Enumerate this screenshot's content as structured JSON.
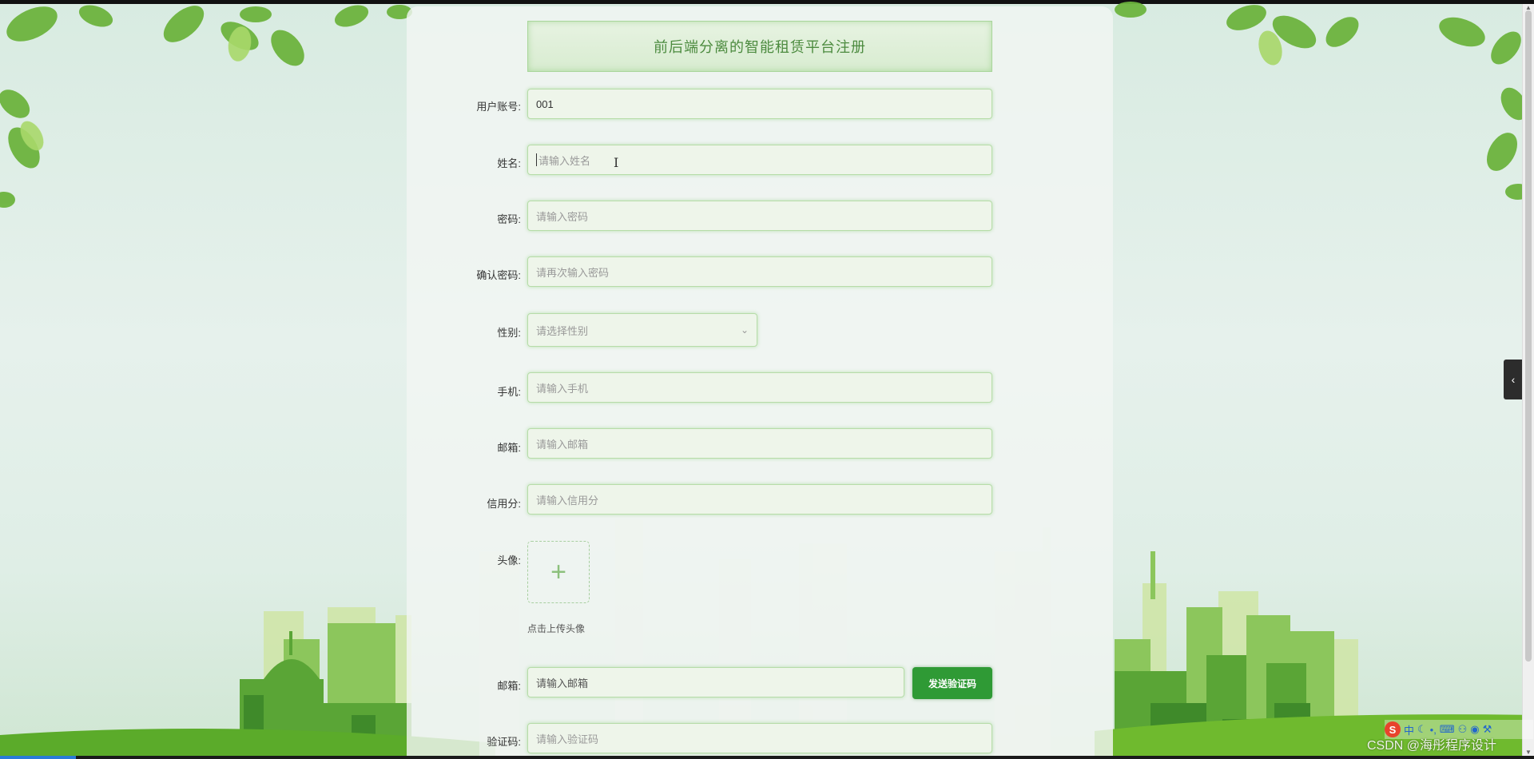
{
  "form": {
    "title": "前后端分离的智能租赁平台注册",
    "fields": [
      {
        "label": "用户账号:",
        "value": "001",
        "placeholder": ""
      },
      {
        "label": "姓名:",
        "value": "",
        "placeholder": "请输入姓名"
      },
      {
        "label": "密码:",
        "value": "",
        "placeholder": "请输入密码"
      },
      {
        "label": "确认密码:",
        "value": "",
        "placeholder": "请再次输入密码"
      },
      {
        "label": "性别:",
        "value": "",
        "placeholder": "请选择性别"
      },
      {
        "label": "手机:",
        "value": "",
        "placeholder": "请输入手机"
      },
      {
        "label": "邮箱:",
        "value": "",
        "placeholder": "请输入邮箱"
      },
      {
        "label": "信用分:",
        "value": "",
        "placeholder": "请输入信用分"
      }
    ],
    "avatar": {
      "label": "头像:",
      "upload_tip": "点击上传头像"
    },
    "email_verify": {
      "label": "邮箱:",
      "placeholder": "请输入邮箱",
      "button": "发送验证码"
    },
    "code": {
      "label": "验证码:",
      "placeholder": "请输入验证码"
    }
  },
  "watermark": "CSDN @海彤程序设计",
  "ime": {
    "logo": "S",
    "mode": "中"
  },
  "colors": {
    "accent": "#2f9a35",
    "title_text": "#4c8b3f",
    "field_border": "#b6dca8"
  }
}
